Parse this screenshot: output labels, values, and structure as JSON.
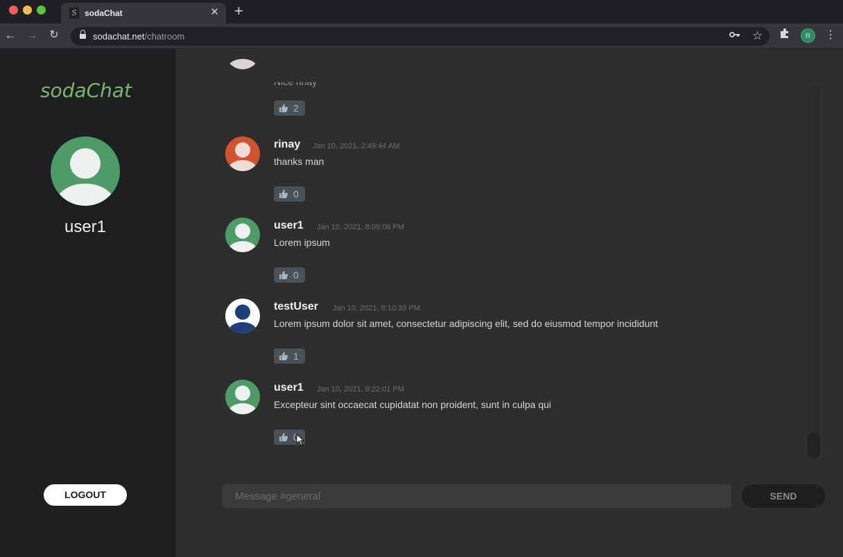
{
  "browser": {
    "tab_title": "sodaChat",
    "tab_favicon": "S",
    "url_host": "sodachat.net",
    "url_path": "/chatroom",
    "profile_initial": "R"
  },
  "sidebar": {
    "logo": "sodaChat",
    "username": "user1",
    "logout_label": "LOGOUT",
    "avatar_color": "#4e9b69"
  },
  "messages": [
    {
      "name": "",
      "time": "",
      "text": "Nice rinay",
      "likes": "2"
    },
    {
      "name": "rinay",
      "time": "Jan 10, 2021, 2:49:44 AM",
      "text": "thanks man",
      "likes": "0",
      "avatar_color": "#d2532f"
    },
    {
      "name": "user1",
      "time": "Jan 10, 2021, 8:09:06 PM",
      "text": "Lorem ipsum",
      "likes": "0",
      "avatar_color": "#4e9b69"
    },
    {
      "name": "testUser",
      "time": "Jan 10, 2021, 8:10:33 PM",
      "text": "Lorem ipsum dolor sit amet, consectetur adipiscing elit, sed do eiusmod tempor incididunt",
      "likes": "1",
      "avatar_color": "#ffffff",
      "avatar_figure_color": "#1f3f7a"
    },
    {
      "name": "user1",
      "time": "Jan 10, 2021, 8:22:01 PM",
      "text": "Excepteur sint occaecat cupidatat non proident, sunt in culpa qui",
      "likes": "0",
      "avatar_color": "#4e9b69"
    }
  ],
  "composer": {
    "placeholder": "Message #general",
    "send_label": "SEND"
  }
}
